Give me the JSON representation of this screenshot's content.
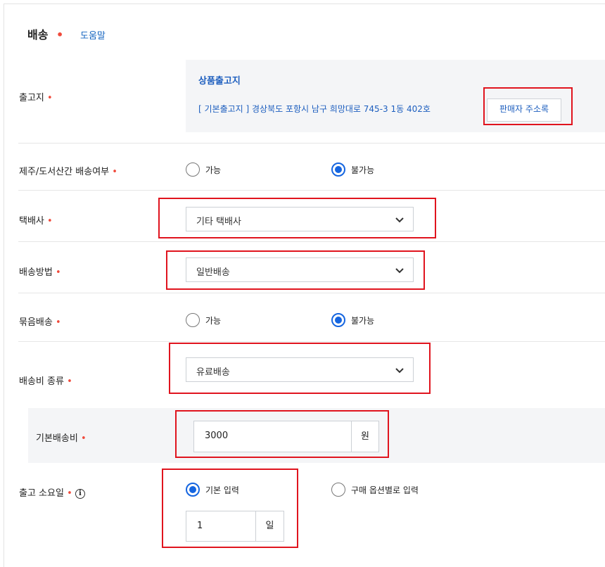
{
  "section": {
    "title": "배송",
    "help_link": "도움말"
  },
  "required_mark": "•",
  "origin": {
    "label": "출고지",
    "title": "상품출고지",
    "address": "[ 기본출고지 ] 경상북도 포항시 남구 희망대로 745-3 1동 402호",
    "address_book_button": "판매자 주소록"
  },
  "jeju": {
    "label": "제주/도서산간 배송여부",
    "options": [
      "가능",
      "불가능"
    ],
    "selected": "불가능"
  },
  "courier": {
    "label": "택배사",
    "value": "기타 택배사"
  },
  "method": {
    "label": "배송방법",
    "value": "일반배송"
  },
  "bundle": {
    "label": "묶음배송",
    "options": [
      "가능",
      "불가능"
    ],
    "selected": "불가능"
  },
  "fee_type": {
    "label": "배송비 종류",
    "value": "유료배송"
  },
  "base_fee": {
    "label": "기본배송비",
    "value": "3000",
    "unit": "원"
  },
  "lead_time": {
    "label": "출고 소요일",
    "info_icon": "info-icon",
    "options": [
      "기본 입력",
      "구매 옵션별로 입력"
    ],
    "selected": "기본 입력",
    "value": "1",
    "unit": "일"
  },
  "colors": {
    "required": "#f04a3b",
    "accent": "#1565e0",
    "link": "#1e5fbf",
    "highlight_box": "#e0141e"
  }
}
